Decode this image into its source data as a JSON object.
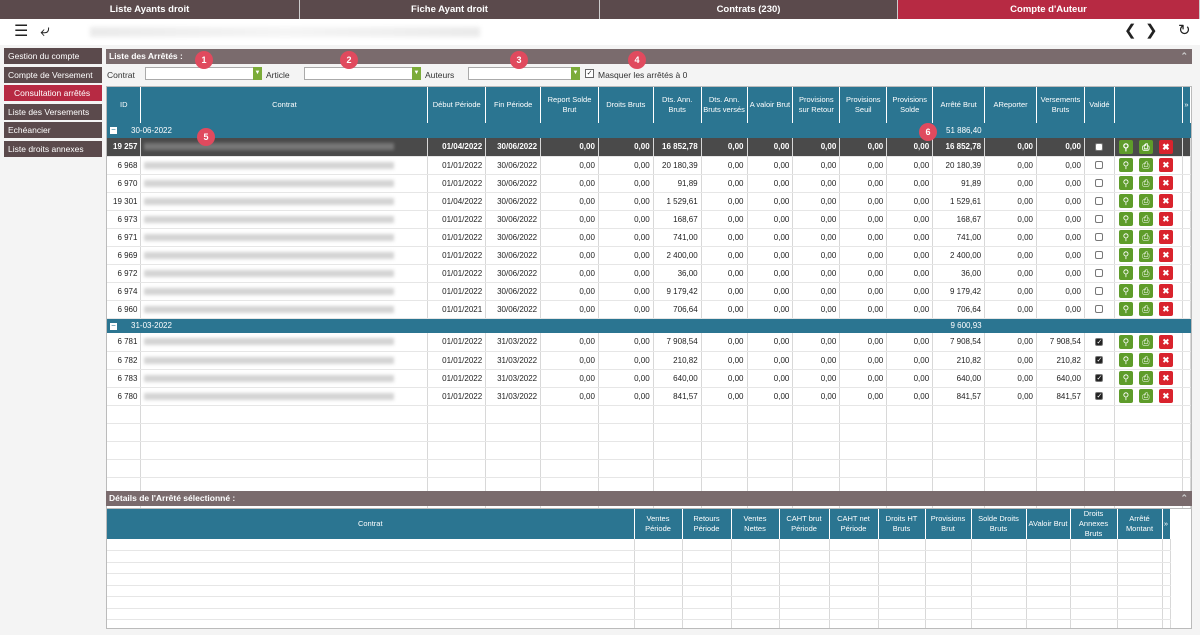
{
  "tabs": [
    {
      "label": "Liste Ayants droit",
      "active": false
    },
    {
      "label": "Fiche Ayant droit",
      "active": false
    },
    {
      "label": "Contrats (230)",
      "active": false
    },
    {
      "label": "Compte d'Auteur",
      "active": true
    }
  ],
  "toolbar": {
    "menu_icon": "hamburger-icon",
    "back_icon": "back-arrow-icon",
    "prev_icon": "chevron-left-icon",
    "next_icon": "chevron-right-icon",
    "refresh_icon": "refresh-icon"
  },
  "sidebar": {
    "items": [
      {
        "label": "Gestion du compte",
        "active": false
      },
      {
        "label": "Compte de Versement",
        "active": false
      },
      {
        "label": "Consultation arrêtés",
        "active": true
      },
      {
        "label": "Liste des Versements",
        "active": false
      },
      {
        "label": "Echéancier",
        "active": false
      },
      {
        "label": "Liste droits annexes",
        "active": false
      }
    ]
  },
  "arretes": {
    "title": "Liste des Arrêtés :",
    "filters": {
      "contrat_label": "Contrat",
      "article_label": "Article",
      "auteurs_label": "Auteurs",
      "masquer_label": "Masquer les arrêtés à 0",
      "masquer_checked": true
    },
    "badges": [
      "1",
      "2",
      "3",
      "4",
      "5",
      "6"
    ],
    "columns": [
      "ID",
      "Contrat",
      "Début Période",
      "Fin Période",
      "Report Solde Brut",
      "Droits Bruts",
      "Dts. Ann. Bruts",
      "Dts. Ann. Bruts versés",
      "A valoir Brut",
      "Provisions sur Retour",
      "Provisions Seuil",
      "Provisions Solde",
      "Arrêté Brut",
      "AReporter",
      "Versements Bruts",
      "Validé"
    ],
    "groups": [
      {
        "label": "30-06-2022",
        "total": "51 886,40",
        "rows": [
          {
            "id": "19 257",
            "debut": "01/04/2022",
            "fin": "30/06/2022",
            "report": "0,00",
            "droits": "0,00",
            "dts": "16 852,78",
            "dtsv": "0,00",
            "avaloir": "0,00",
            "provr": "0,00",
            "provs": "0,00",
            "provsol": "0,00",
            "arrete": "16 852,78",
            "areporter": "0,00",
            "vers": "0,00",
            "valide": false,
            "selected": true
          },
          {
            "id": "6 968",
            "debut": "01/01/2022",
            "fin": "30/06/2022",
            "report": "0,00",
            "droits": "0,00",
            "dts": "20 180,39",
            "dtsv": "0,00",
            "avaloir": "0,00",
            "provr": "0,00",
            "provs": "0,00",
            "provsol": "0,00",
            "arrete": "20 180,39",
            "areporter": "0,00",
            "vers": "0,00",
            "valide": false,
            "selected": false
          },
          {
            "id": "6 970",
            "debut": "01/01/2022",
            "fin": "30/06/2022",
            "report": "0,00",
            "droits": "0,00",
            "dts": "91,89",
            "dtsv": "0,00",
            "avaloir": "0,00",
            "provr": "0,00",
            "provs": "0,00",
            "provsol": "0,00",
            "arrete": "91,89",
            "areporter": "0,00",
            "vers": "0,00",
            "valide": false,
            "selected": false
          },
          {
            "id": "19 301",
            "debut": "01/04/2022",
            "fin": "30/06/2022",
            "report": "0,00",
            "droits": "0,00",
            "dts": "1 529,61",
            "dtsv": "0,00",
            "avaloir": "0,00",
            "provr": "0,00",
            "provs": "0,00",
            "provsol": "0,00",
            "arrete": "1 529,61",
            "areporter": "0,00",
            "vers": "0,00",
            "valide": false,
            "selected": false
          },
          {
            "id": "6 973",
            "debut": "01/01/2022",
            "fin": "30/06/2022",
            "report": "0,00",
            "droits": "0,00",
            "dts": "168,67",
            "dtsv": "0,00",
            "avaloir": "0,00",
            "provr": "0,00",
            "provs": "0,00",
            "provsol": "0,00",
            "arrete": "168,67",
            "areporter": "0,00",
            "vers": "0,00",
            "valide": false,
            "selected": false
          },
          {
            "id": "6 971",
            "debut": "01/01/2022",
            "fin": "30/06/2022",
            "report": "0,00",
            "droits": "0,00",
            "dts": "741,00",
            "dtsv": "0,00",
            "avaloir": "0,00",
            "provr": "0,00",
            "provs": "0,00",
            "provsol": "0,00",
            "arrete": "741,00",
            "areporter": "0,00",
            "vers": "0,00",
            "valide": false,
            "selected": false
          },
          {
            "id": "6 969",
            "debut": "01/01/2022",
            "fin": "30/06/2022",
            "report": "0,00",
            "droits": "0,00",
            "dts": "2 400,00",
            "dtsv": "0,00",
            "avaloir": "0,00",
            "provr": "0,00",
            "provs": "0,00",
            "provsol": "0,00",
            "arrete": "2 400,00",
            "areporter": "0,00",
            "vers": "0,00",
            "valide": false,
            "selected": false
          },
          {
            "id": "6 972",
            "debut": "01/01/2022",
            "fin": "30/06/2022",
            "report": "0,00",
            "droits": "0,00",
            "dts": "36,00",
            "dtsv": "0,00",
            "avaloir": "0,00",
            "provr": "0,00",
            "provs": "0,00",
            "provsol": "0,00",
            "arrete": "36,00",
            "areporter": "0,00",
            "vers": "0,00",
            "valide": false,
            "selected": false
          },
          {
            "id": "6 974",
            "debut": "01/01/2022",
            "fin": "30/06/2022",
            "report": "0,00",
            "droits": "0,00",
            "dts": "9 179,42",
            "dtsv": "0,00",
            "avaloir": "0,00",
            "provr": "0,00",
            "provs": "0,00",
            "provsol": "0,00",
            "arrete": "9 179,42",
            "areporter": "0,00",
            "vers": "0,00",
            "valide": false,
            "selected": false
          },
          {
            "id": "6 960",
            "debut": "01/01/2021",
            "fin": "30/06/2022",
            "report": "0,00",
            "droits": "0,00",
            "dts": "706,64",
            "dtsv": "0,00",
            "avaloir": "0,00",
            "provr": "0,00",
            "provs": "0,00",
            "provsol": "0,00",
            "arrete": "706,64",
            "areporter": "0,00",
            "vers": "0,00",
            "valide": false,
            "selected": false
          }
        ]
      },
      {
        "label": "31-03-2022",
        "total": "9 600,93",
        "rows": [
          {
            "id": "6 781",
            "debut": "01/01/2022",
            "fin": "31/03/2022",
            "report": "0,00",
            "droits": "0,00",
            "dts": "7 908,54",
            "dtsv": "0,00",
            "avaloir": "0,00",
            "provr": "0,00",
            "provs": "0,00",
            "provsol": "0,00",
            "arrete": "7 908,54",
            "areporter": "0,00",
            "vers": "7 908,54",
            "valide": true,
            "selected": false
          },
          {
            "id": "6 782",
            "debut": "01/01/2022",
            "fin": "31/03/2022",
            "report": "0,00",
            "droits": "0,00",
            "dts": "210,82",
            "dtsv": "0,00",
            "avaloir": "0,00",
            "provr": "0,00",
            "provs": "0,00",
            "provsol": "0,00",
            "arrete": "210,82",
            "areporter": "0,00",
            "vers": "210,82",
            "valide": true,
            "selected": false
          },
          {
            "id": "6 783",
            "debut": "01/01/2022",
            "fin": "31/03/2022",
            "report": "0,00",
            "droits": "0,00",
            "dts": "640,00",
            "dtsv": "0,00",
            "avaloir": "0,00",
            "provr": "0,00",
            "provs": "0,00",
            "provsol": "0,00",
            "arrete": "640,00",
            "areporter": "0,00",
            "vers": "640,00",
            "valide": true,
            "selected": false
          },
          {
            "id": "6 780",
            "debut": "01/01/2022",
            "fin": "31/03/2022",
            "report": "0,00",
            "droits": "0,00",
            "dts": "841,57",
            "dtsv": "0,00",
            "avaloir": "0,00",
            "provr": "0,00",
            "provs": "0,00",
            "provsol": "0,00",
            "arrete": "841,57",
            "areporter": "0,00",
            "vers": "841,57",
            "valide": true,
            "selected": false
          }
        ]
      }
    ]
  },
  "details": {
    "title": "Détails de l'Arrêté sélectionné :",
    "columns": [
      "Contrat",
      "Ventes Période",
      "Retours Période",
      "Ventes Nettes",
      "CAHT brut Période",
      "CAHT net Période",
      "Droits HT Bruts",
      "Provisions Brut",
      "Solde Droits Bruts",
      "AValoir Brut",
      "Droits Annexes Bruts",
      "Arrêté Montant"
    ]
  }
}
